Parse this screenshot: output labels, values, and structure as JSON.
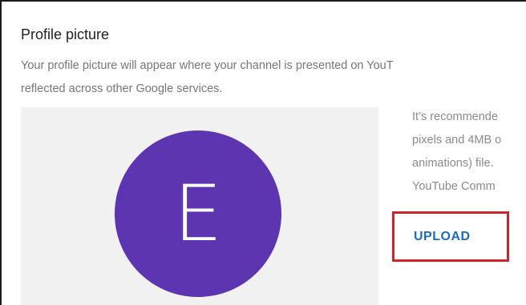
{
  "section": {
    "title": "Profile picture",
    "description_lines": [
      "Your profile picture will appear where your channel is presented on YouT",
      "reflected across other Google services."
    ]
  },
  "avatar": {
    "letter": "E",
    "color": "#5e35b1"
  },
  "hint_lines": [
    "It’s recommende",
    "pixels and 4MB o",
    "animations) file.",
    "YouTube Comm"
  ],
  "upload": {
    "label": "UPLOAD",
    "highlight_color": "#d0232b"
  }
}
